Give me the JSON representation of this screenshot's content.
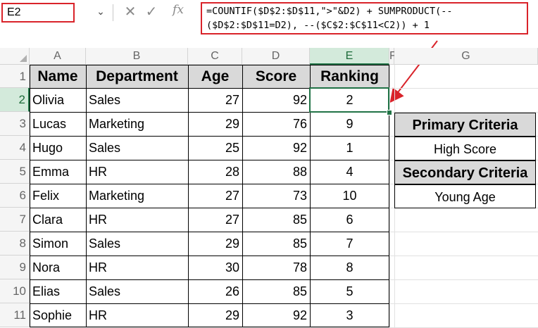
{
  "formula_bar": {
    "name_box": "E2",
    "dropdown_icon": "chevron-down-icon",
    "cancel_icon": "✕",
    "enter_icon": "✓",
    "fx_label": "fx",
    "formula_line1": "=COUNTIF($D$2:$D$11,\">\"&D2) + SUMPRODUCT(--",
    "formula_line2": "($D$2:$D$11=D2), --($C$2:$C$11<C2)) + 1"
  },
  "columns": [
    "A",
    "B",
    "C",
    "D",
    "E",
    "F",
    "G"
  ],
  "rows": [
    "1",
    "2",
    "3",
    "4",
    "5",
    "6",
    "7",
    "8",
    "9",
    "10",
    "11"
  ],
  "table": {
    "headers": [
      "Name",
      "Department",
      "Age",
      "Score",
      "Ranking"
    ],
    "data": [
      [
        "Olivia",
        "Sales",
        "27",
        "92",
        "2"
      ],
      [
        "Lucas",
        "Marketing",
        "29",
        "76",
        "9"
      ],
      [
        "Hugo",
        "Sales",
        "25",
        "92",
        "1"
      ],
      [
        "Emma",
        "HR",
        "28",
        "88",
        "4"
      ],
      [
        "Felix",
        "Marketing",
        "27",
        "73",
        "10"
      ],
      [
        "Clara",
        "HR",
        "27",
        "85",
        "6"
      ],
      [
        "Simon",
        "Sales",
        "29",
        "85",
        "7"
      ],
      [
        "Nora",
        "HR",
        "30",
        "78",
        "8"
      ],
      [
        "Elias",
        "Sales",
        "26",
        "85",
        "5"
      ],
      [
        "Sophie",
        "HR",
        "29",
        "92",
        "3"
      ]
    ]
  },
  "criteria": {
    "primary_title": "Primary Criteria",
    "primary_value": "High Score",
    "secondary_title": "Secondary Criteria",
    "secondary_value": "Young Age"
  },
  "colors": {
    "highlight_border": "#d9232a",
    "selection_green": "#217346",
    "header_fill": "#d9d9d9"
  }
}
